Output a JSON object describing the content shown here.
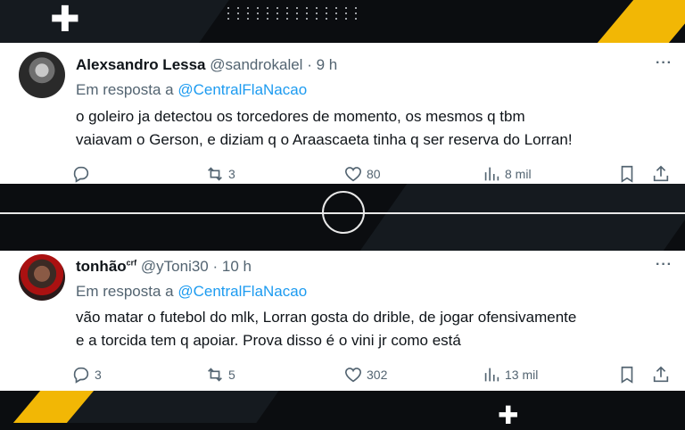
{
  "tweets": [
    {
      "name": "Alexsandro Lessa",
      "badge": "",
      "handle": "@sandrokalel",
      "separator": "·",
      "time": "9 h",
      "more": "···",
      "reply_prefix": "Em resposta a",
      "reply_mention": "@CentralFlaNacao",
      "text_lines": [
        "o goleiro ja detectou os torcedores de momento, os mesmos q tbm",
        "vaiavam o Gerson, e diziam q o Araascaeta tinha q ser reserva do Lorran!"
      ],
      "stats": {
        "replies": "",
        "retweets": "3",
        "likes": "80",
        "views": "8 mil"
      }
    },
    {
      "name": "tonhão",
      "badge": "crf",
      "handle": "@yToni30",
      "separator": "·",
      "time": "10 h",
      "more": "···",
      "reply_prefix": "Em resposta a",
      "reply_mention": "@CentralFlaNacao",
      "text_lines": [
        "vão matar o futebol do mlk, Lorran gosta do drible, de jogar ofensivamente",
        "e a torcida tem q apoiar. Prova disso é o vini jr como está"
      ],
      "stats": {
        "replies": "3",
        "retweets": "5",
        "likes": "302",
        "views": "13 mil"
      }
    }
  ],
  "icons": [
    "reply-icon",
    "retweet-icon",
    "like-icon",
    "views-icon",
    "bookmark-icon",
    "share-icon"
  ],
  "colors": {
    "link": "#1d9bf0",
    "muted": "#536471",
    "text": "#0f1419",
    "accent_yellow": "#f2b705"
  }
}
